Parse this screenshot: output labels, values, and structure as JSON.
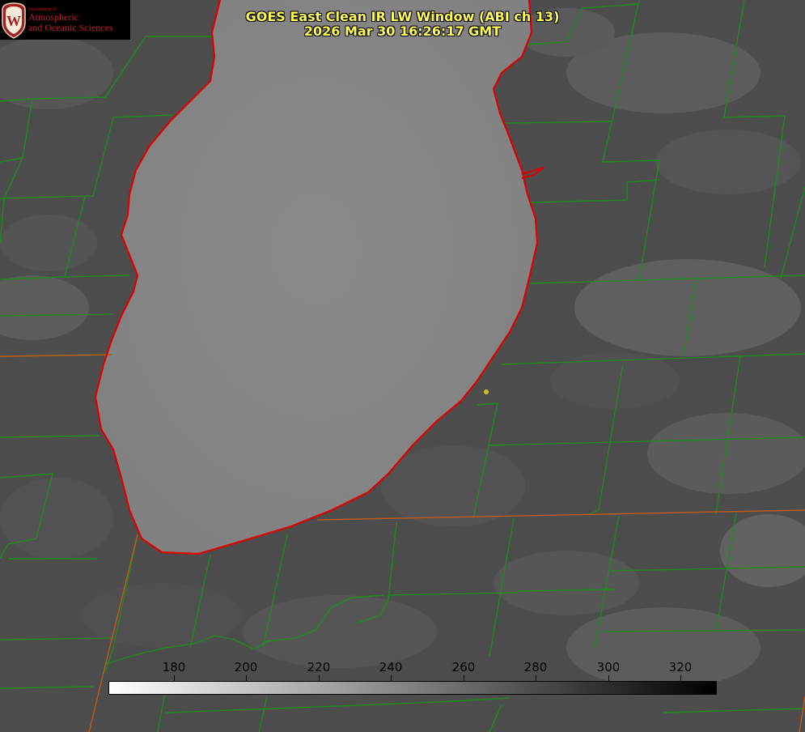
{
  "header": {
    "title_line1": "GOES East Clean IR LW Window (ABI ch 13)",
    "title_line2": "2026 Mar 30 16:26:17 GMT"
  },
  "logo": {
    "seal_letter": "W",
    "department": "Department of",
    "line1": "Atmospheric",
    "line2": "and Oceanic Sciences",
    "color": "#c41e2a"
  },
  "colorbar": {
    "ticks": [
      "180",
      "200",
      "220",
      "240",
      "260",
      "280",
      "300",
      "320"
    ],
    "gradient": [
      "#ffffff",
      "#000000"
    ]
  },
  "colors": {
    "county_lines": "#1f8a1f",
    "state_lines": "#c05a1a",
    "shoreline": "#e00000",
    "title": "#ffff55",
    "marker": "#d6c020"
  }
}
